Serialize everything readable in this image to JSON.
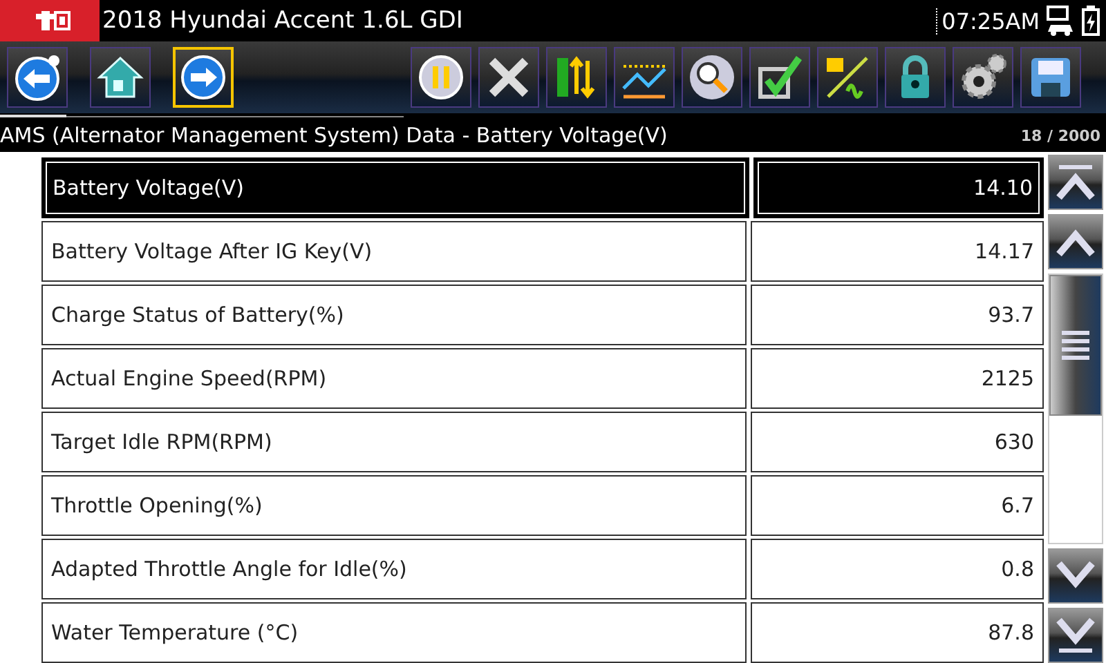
{
  "title_bar": {
    "vehicle": "2018 Hyundai Accent 1.6L GDI",
    "time": "07:25AM"
  },
  "toolbar": [
    {
      "kind": "back",
      "selected": false
    },
    {
      "kind": "home",
      "selected": false
    },
    {
      "kind": "forward",
      "selected": true
    },
    {
      "kind": "pause",
      "selected": false
    },
    {
      "kind": "close",
      "selected": false
    },
    {
      "kind": "sort",
      "selected": false
    },
    {
      "kind": "graph",
      "selected": false
    },
    {
      "kind": "zoom",
      "selected": false
    },
    {
      "kind": "check",
      "selected": false
    },
    {
      "kind": "units",
      "selected": false
    },
    {
      "kind": "lock",
      "selected": false
    },
    {
      "kind": "settings",
      "selected": false
    },
    {
      "kind": "save",
      "selected": false
    }
  ],
  "subtitle": {
    "text": "AMS (Alternator Management System) Data - Battery Voltage(V)",
    "counter": "18 / 2000"
  },
  "rows": [
    {
      "name": "Battery Voltage(V)",
      "value": "14.10",
      "selected": true
    },
    {
      "name": "Battery Voltage After IG Key(V)",
      "value": "14.17",
      "selected": false
    },
    {
      "name": "Charge Status of Battery(%)",
      "value": "93.7",
      "selected": false
    },
    {
      "name": "Actual Engine Speed(RPM)",
      "value": "2125",
      "selected": false
    },
    {
      "name": "Target Idle RPM(RPM)",
      "value": "630",
      "selected": false
    },
    {
      "name": "Throttle Opening(%)",
      "value": "6.7",
      "selected": false
    },
    {
      "name": "Adapted Throttle Angle for Idle(%)",
      "value": "0.8",
      "selected": false
    },
    {
      "name": "Water Temperature (°C)",
      "value": "87.8",
      "selected": false
    }
  ]
}
